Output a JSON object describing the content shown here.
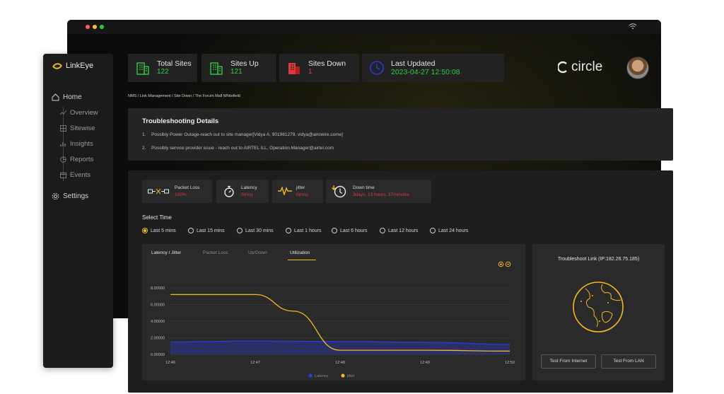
{
  "app": {
    "name": "LinkEye",
    "brand": "circle"
  },
  "sidebar": {
    "home": "Home",
    "items": [
      {
        "label": "Overview",
        "icon": "chart-line-icon"
      },
      {
        "label": "Sitewise",
        "icon": "grid-icon"
      },
      {
        "label": "Insights",
        "icon": "bar-chart-icon"
      },
      {
        "label": "Reports",
        "icon": "report-icon"
      },
      {
        "label": "Events",
        "icon": "calendar-icon"
      }
    ],
    "settings": "Settings"
  },
  "stats": {
    "total_sites": {
      "label": "Total Sites",
      "value": "122"
    },
    "sites_up": {
      "label": "Sites Up",
      "value": "121"
    },
    "sites_down": {
      "label": "Sites Down",
      "value": "1"
    },
    "last_updated": {
      "label": "Last Updated",
      "value": "2023-04-27 12:50:08"
    }
  },
  "breadcrumb": "NMS / Link Management / Site Down / The Forum Mall Whitefield",
  "troubleshooting": {
    "title": "Troubleshooting Details",
    "items": [
      {
        "n": "1.",
        "text": "Possibly Power Outage-reach out to site manager[Vidya A, 901961279, vidya@airowire.come]"
      },
      {
        "n": "2.",
        "text": "Possibly service provider issue - reach out to AIRTEL ILL, Operation.Manager@airtel.com"
      }
    ]
  },
  "metrics": {
    "packet_loss": {
      "label": "Packet Loss",
      "value": "100%"
    },
    "latency": {
      "label": "Latency",
      "value": "0(ms)"
    },
    "jitter": {
      "label": "jitter",
      "value": "0(ms)"
    },
    "downtime": {
      "label": "Down time",
      "value": "3days, 13 hours, 37minutes"
    }
  },
  "select_time": {
    "label": "Select Time",
    "options": [
      "Last 5 mins",
      "Last 15 mins",
      "Last 30 mins",
      "Last 1 hours",
      "Last 6 hours",
      "Last 12 hours",
      "Last 24 hours"
    ],
    "selected": "Last 5 mins"
  },
  "chart_tabs": [
    "Latency / Jitter",
    "Packet Loss",
    "Up/Down",
    "Utilization"
  ],
  "active_tab": "Utilization",
  "troubleshoot_link": {
    "title": "Troubleshoot Link (IP:182.26.75.185)",
    "buttons": [
      "Test From Internet",
      "Test From LAN"
    ]
  },
  "colors": {
    "accent": "#f2b81c",
    "up": "#2ecc40",
    "down": "#e03a3a",
    "latency": "#2b3bd6",
    "jitter": "#f2b81c"
  },
  "chart_data": {
    "type": "line",
    "x": [
      "12:46",
      "12:47",
      "12:48",
      "12:49",
      "12:50"
    ],
    "ylim": [
      0,
      8
    ],
    "yticks": [
      "0.00000",
      "2.00000",
      "4.00000",
      "6.00000",
      "8.00000"
    ],
    "series": [
      {
        "name": "Latency",
        "color": "#2b3bd6",
        "points": [
          [
            0,
            1.5
          ],
          [
            1,
            1.6
          ],
          [
            2,
            1.55
          ],
          [
            3,
            1.45
          ],
          [
            4,
            1.2
          ]
        ]
      },
      {
        "name": "jitter",
        "color": "#f2b81c",
        "points": [
          [
            0,
            7.2
          ],
          [
            1,
            7.2
          ],
          [
            1.45,
            5.2
          ],
          [
            2,
            0.5
          ],
          [
            3,
            0.5
          ],
          [
            4,
            0.4
          ]
        ]
      }
    ],
    "legend": "bottom",
    "grid": true
  }
}
